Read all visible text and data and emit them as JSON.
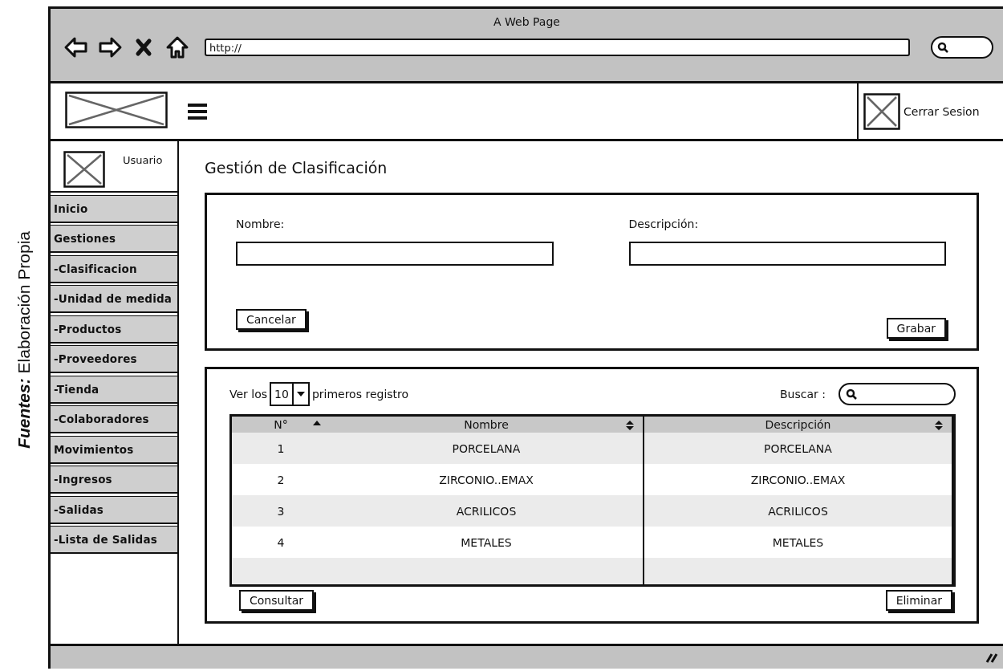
{
  "caption": "**Fuentes:** Elaboración Propia",
  "browser": {
    "title": "A Web Page",
    "url": "http://"
  },
  "header": {
    "logout": "Cerrar Sesion"
  },
  "sidebar": {
    "user": "Usuario",
    "items": [
      {
        "label": "Inicio"
      },
      {
        "label": "Gestiones"
      },
      {
        "label": "-Clasificacion"
      },
      {
        "label": "-Unidad de medida"
      },
      {
        "label": "-Productos"
      },
      {
        "label": "-Proveedores"
      },
      {
        "label": "-Tienda"
      },
      {
        "label": "-Colaboradores"
      },
      {
        "label": "Movimientos"
      },
      {
        "label": "-Ingresos"
      },
      {
        "label": "-Salidas"
      },
      {
        "label": "-Lista de Salidas"
      }
    ]
  },
  "page_title": "Gestión de Clasificación",
  "form": {
    "fields": [
      {
        "label": "Nombre:"
      },
      {
        "label": "Descripción:"
      }
    ],
    "buttons": [
      "Cancelar",
      "Grabar"
    ]
  },
  "table_controls": {
    "show_prefix": "Ver los",
    "page_size": "10",
    "show_suffix": "primeros registro",
    "search_label": "Buscar :"
  },
  "table": {
    "columns": [
      {
        "label": "N°",
        "kind": "sort_asc"
      },
      {
        "label": "Nombre",
        "kind": "sort_both"
      },
      {
        "label": "Descripción",
        "kind": "sort_both"
      }
    ],
    "rows": [
      [
        "1",
        "PORCELANA",
        "PORCELANA"
      ],
      [
        "2",
        "ZIRCONIO..EMAX",
        "ZIRCONIO..EMAX"
      ],
      [
        "3",
        "ACRILICOS",
        "ACRILICOS"
      ],
      [
        "4",
        "METALES",
        "METALES"
      ]
    ]
  },
  "actions": [
    "Consultar",
    "Eliminar"
  ]
}
